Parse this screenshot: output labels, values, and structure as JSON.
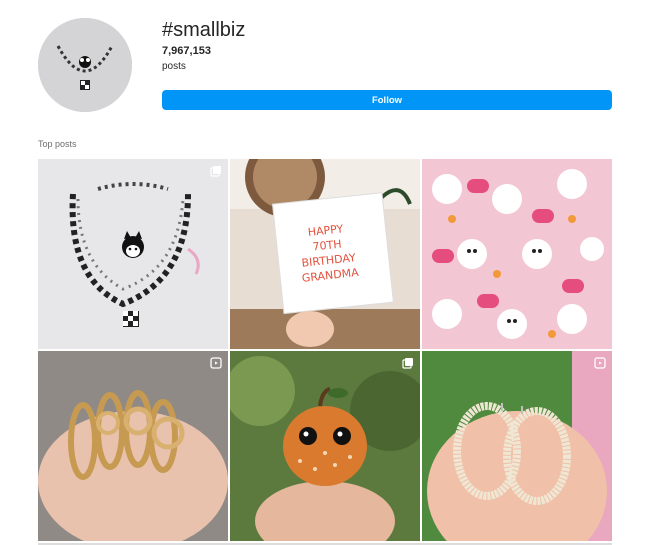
{
  "header": {
    "hashtag": "#smallbiz",
    "post_count": "7,967,153",
    "post_count_label": "posts",
    "follow_label": "Follow"
  },
  "section": {
    "title": "Top posts"
  },
  "card": {
    "text": "HAPPY 70TH BIRTHDAY GRANDMA"
  },
  "colors": {
    "accent": "#0095f6",
    "text": "#262626",
    "muted": "#6d6d6d"
  },
  "posts": [
    {
      "subject": "necklace",
      "badge": "multiple-icon"
    },
    {
      "subject": "birthday-card",
      "badge": ""
    },
    {
      "subject": "clay-earrings",
      "badge": ""
    },
    {
      "subject": "gold-rings",
      "badge": "reel-icon"
    },
    {
      "subject": "pumpkin-figurine",
      "badge": "multiple-icon"
    },
    {
      "subject": "hoop-earrings",
      "badge": "reel-icon"
    }
  ]
}
